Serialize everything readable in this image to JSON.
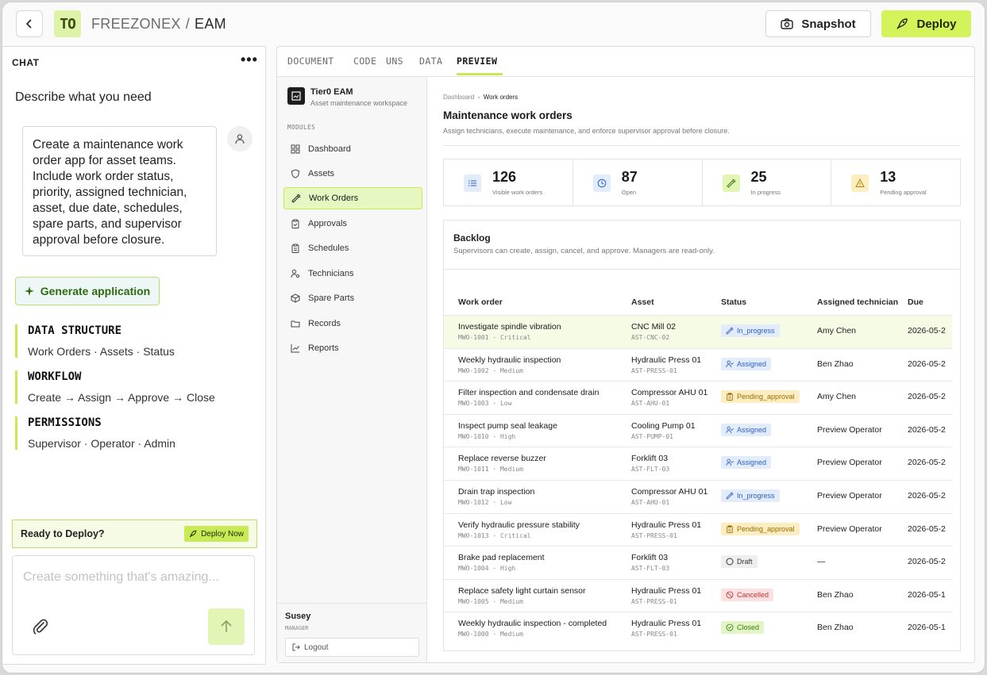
{
  "header": {
    "logo_text": "TO",
    "breadcrumb_project": "FREEZONEX",
    "breadcrumb_sep": "/",
    "breadcrumb_app": "EAM",
    "snapshot_label": "Snapshot",
    "deploy_label": "Deploy"
  },
  "chat": {
    "title": "CHAT",
    "menu": "•••",
    "heading": "Describe what you need",
    "message": "Create a maintenance work order app for asset teams. Include work order status, priority, assigned technician, asset, due date, schedules, spare parts, and supervisor approval before closure.",
    "generate_label": "Generate application",
    "sections": [
      {
        "title": "DATA STRUCTURE",
        "body": "Work Orders · Assets · Status"
      },
      {
        "title": "WORKFLOW",
        "body": "Create → Assign → Approve → Close"
      },
      {
        "title": "PERMISSIONS",
        "body": "Supervisor · Operator · Admin"
      }
    ],
    "ready_text": "Ready to Deploy?",
    "deploy_now_label": "Deploy Now",
    "input_placeholder": "Create something that's amazing..."
  },
  "tabs": [
    "DOCUMENT",
    "CODE",
    "UNS",
    "DATA",
    "PREVIEW"
  ],
  "active_tab": "PREVIEW",
  "sidebar": {
    "workspace_name": "Tier0 EAM",
    "workspace_sub": "Asset maintenance workspace",
    "modules_heading": "MODULES",
    "items": [
      {
        "label": "Dashboard",
        "icon": "dashboard-icon"
      },
      {
        "label": "Assets",
        "icon": "shield-icon"
      },
      {
        "label": "Work Orders",
        "icon": "wrench-icon",
        "active": true
      },
      {
        "label": "Approvals",
        "icon": "clipboard-check-icon"
      },
      {
        "label": "Schedules",
        "icon": "clipboard-list-icon"
      },
      {
        "label": "Technicians",
        "icon": "user-cog-icon"
      },
      {
        "label": "Spare Parts",
        "icon": "package-icon"
      },
      {
        "label": "Records",
        "icon": "folder-icon"
      },
      {
        "label": "Reports",
        "icon": "chart-line-icon"
      }
    ],
    "user_name": "Susey",
    "user_role": "MANAGER",
    "logout_label": "Logout"
  },
  "page": {
    "breadcrumb_root": "Dashboard",
    "breadcrumb_current": "Work orders",
    "title": "Maintenance work orders",
    "subtitle": "Assign technicians, execute maintenance, and enforce supervisor approval before closure."
  },
  "stats": [
    {
      "value": "126",
      "label": "Visible work orders",
      "icon": "list-icon",
      "color": "#e2ecfb"
    },
    {
      "value": "87",
      "label": "Open",
      "icon": "clock-icon",
      "color": "#e2ecfb"
    },
    {
      "value": "25",
      "label": "In progress",
      "icon": "wrench-icon",
      "color": "#e3f5b5"
    },
    {
      "value": "13",
      "label": "Pending approval",
      "icon": "warning-icon",
      "color": "#fdeec2"
    }
  ],
  "backlog": {
    "title": "Backlog",
    "subtitle": "Supervisors can create, assign, cancel, and approve. Managers are read-only.",
    "columns": [
      "Work order",
      "Asset",
      "Status",
      "Assigned technician",
      "Due"
    ],
    "rows": [
      {
        "title": "Investigate spindle vibration",
        "meta": "MWO-1001 · Critical",
        "asset": "CNC Mill 02",
        "asset_code": "AST-CNC-02",
        "status": "In_progress",
        "tech": "Amy Chen",
        "due": "2026-05-2"
      },
      {
        "title": "Weekly hydraulic inspection",
        "meta": "MWO-1002 · Medium",
        "asset": "Hydraulic Press 01",
        "asset_code": "AST-PRESS-01",
        "status": "Assigned",
        "tech": "Ben Zhao",
        "due": "2026-05-2"
      },
      {
        "title": "Filter inspection and condensate drain",
        "meta": "MWO-1003 · Low",
        "asset": "Compressor AHU 01",
        "asset_code": "AST-AHU-01",
        "status": "Pending_approval",
        "tech": "Amy Chen",
        "due": "2026-05-2"
      },
      {
        "title": "Inspect pump seal leakage",
        "meta": "MWO-1010 · High",
        "asset": "Cooling Pump 01",
        "asset_code": "AST-PUMP-01",
        "status": "Assigned",
        "tech": "Preview Operator",
        "due": "2026-05-2"
      },
      {
        "title": "Replace reverse buzzer",
        "meta": "MWO-1011 · Medium",
        "asset": "Forklift 03",
        "asset_code": "AST-FLT-03",
        "status": "Assigned",
        "tech": "Preview Operator",
        "due": "2026-05-2"
      },
      {
        "title": "Drain trap inspection",
        "meta": "MWO-1012 · Low",
        "asset": "Compressor AHU 01",
        "asset_code": "AST-AHU-01",
        "status": "In_progress",
        "tech": "Preview Operator",
        "due": "2026-05-2"
      },
      {
        "title": "Verify hydraulic pressure stability",
        "meta": "MWO-1013 · Critical",
        "asset": "Hydraulic Press 01",
        "asset_code": "AST-PRESS-01",
        "status": "Pending_approval",
        "tech": "Preview Operator",
        "due": "2026-05-2"
      },
      {
        "title": "Brake pad replacement",
        "meta": "MWO-1004 · High",
        "asset": "Forklift 03",
        "asset_code": "AST-FLT-03",
        "status": "Draft",
        "tech": "—",
        "due": "2026-05-2"
      },
      {
        "title": "Replace safety light curtain sensor",
        "meta": "MWO-1005 · Medium",
        "asset": "Hydraulic Press 01",
        "asset_code": "AST-PRESS-01",
        "status": "Cancelled",
        "tech": "Ben Zhao",
        "due": "2026-05-1"
      },
      {
        "title": "Weekly hydraulic inspection - completed",
        "meta": "MWO-1000 · Medium",
        "asset": "Hydraulic Press 01",
        "asset_code": "AST-PRESS-01",
        "status": "Closed",
        "tech": "Ben Zhao",
        "due": "2026-05-1"
      }
    ]
  },
  "colors": {
    "accent": "#d4f25a",
    "accent_light": "#e6f7c2",
    "in_progress": "#2c5fc4",
    "pending": "#9a6a00",
    "cancelled": "#c23434",
    "closed": "#3b7a12"
  }
}
